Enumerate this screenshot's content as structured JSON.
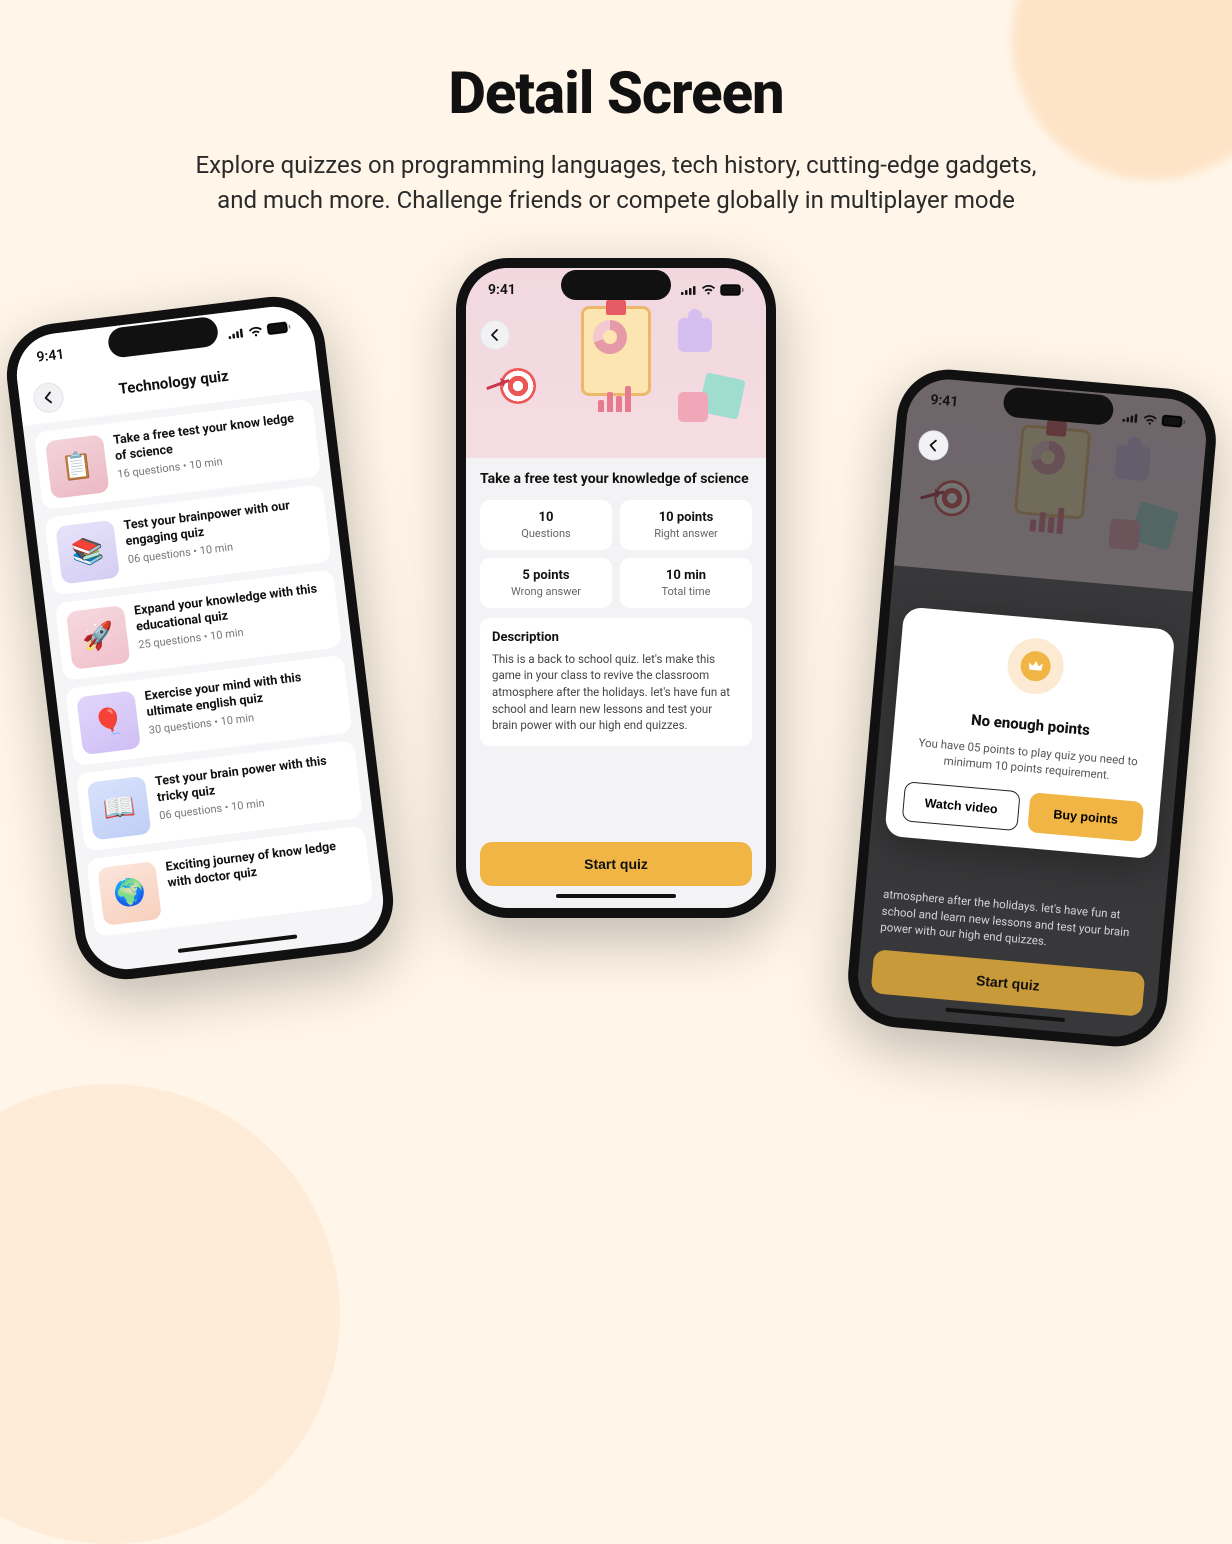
{
  "page": {
    "title": "Detail Screen",
    "subtitle": "Explore quizzes on programming languages, tech history, cutting-edge gadgets, and much more. Challenge friends or compete globally in multiplayer mode"
  },
  "status": {
    "time": "9:41"
  },
  "phone1": {
    "header": "Technology quiz",
    "items": [
      {
        "title": "Take a free test your know ledge of science",
        "meta": "16 questions • 10 min",
        "thumb": "th-pink",
        "glyph": "📋"
      },
      {
        "title": "Test your brainpower with our engaging quiz",
        "meta": "06 questions • 10 min",
        "thumb": "th-lilac",
        "glyph": "📚"
      },
      {
        "title": "Expand your knowledge with this educational quiz",
        "meta": "25 questions • 10 min",
        "thumb": "th-rose",
        "glyph": "🚀"
      },
      {
        "title": "Exercise your mind with this ultimate english quiz",
        "meta": "30 questions • 10 min",
        "thumb": "th-violet",
        "glyph": "🎈"
      },
      {
        "title": "Test your brain power with this tricky quiz",
        "meta": "06 questions • 10 min",
        "thumb": "th-blue",
        "glyph": "📖"
      },
      {
        "title": "Exciting journey of know ledge with doctor quiz",
        "meta": "",
        "thumb": "th-peach",
        "glyph": "🌍"
      }
    ]
  },
  "phone2": {
    "title": "Take a free test your knowledge of science",
    "stats": [
      {
        "v": "10",
        "l": "Questions"
      },
      {
        "v": "10 points",
        "l": "Right answer"
      },
      {
        "v": "5 points",
        "l": "Wrong answer"
      },
      {
        "v": "10 min",
        "l": "Total time"
      }
    ],
    "desc_heading": "Description",
    "desc_text": "This is a back to school quiz. let's make this game in your class to revive the classroom atmosphere after the holidays. let's have fun at school and learn new lessons and test your brain power with our high end quizzes.",
    "cta": "Start quiz"
  },
  "phone3": {
    "modal": {
      "title": "No enough points",
      "body": "You have 05 points to play quiz you need to minimum 10 points requirement.",
      "btn_watch": "Watch video",
      "btn_buy": "Buy points"
    },
    "bg_desc": "atmosphere after the holidays. let's have fun at school and learn new lessons and test your brain power with our high end quizzes.",
    "cta": "Start quiz"
  }
}
